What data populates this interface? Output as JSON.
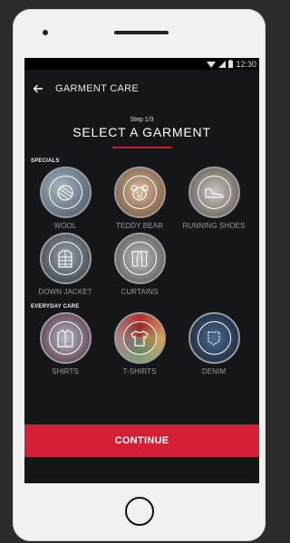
{
  "status": {
    "time": "12:30"
  },
  "appbar": {
    "title": "GARMENT CARE"
  },
  "header": {
    "step": "Step 1/3",
    "title": "SELECT A GARMENT"
  },
  "sections": {
    "specials": {
      "title": "SPECIALS",
      "items": [
        {
          "label": "WOOL",
          "icon": "wool-icon"
        },
        {
          "label": "TEDDY BEAR",
          "icon": "teddy-bear-icon"
        },
        {
          "label": "RUNNING SHOES",
          "icon": "running-shoe-icon"
        },
        {
          "label": "DOWN JACKET",
          "icon": "down-jacket-icon"
        },
        {
          "label": "CURTAINS",
          "icon": "curtains-icon"
        }
      ]
    },
    "everyday": {
      "title": "EVERYDAY CARE",
      "items": [
        {
          "label": "SHIRTS",
          "icon": "shirt-icon"
        },
        {
          "label": "T-SHIRTS",
          "icon": "t-shirt-icon"
        },
        {
          "label": "DENIM",
          "icon": "denim-icon"
        }
      ]
    }
  },
  "footer": {
    "continue_label": "CONTINUE"
  },
  "colors": {
    "accent": "#d41f35",
    "background": "#141618"
  }
}
